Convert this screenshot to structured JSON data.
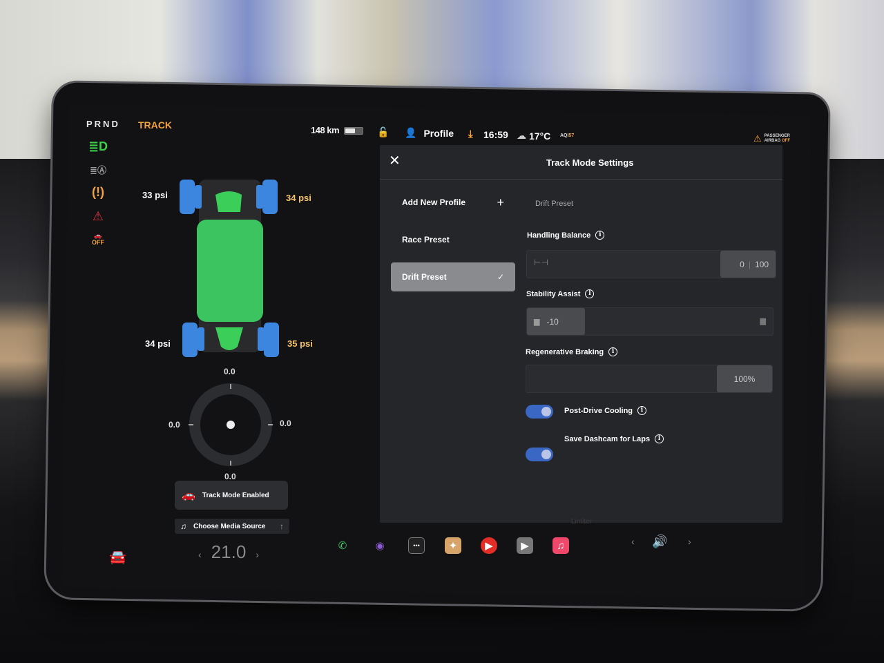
{
  "status_bar": {
    "gear": "PRND",
    "drive_mode": "TRACK",
    "range": "148 km",
    "battery_level": 0.55,
    "profile_label": "Profile",
    "time": "16:59",
    "temperature": "17°C",
    "aqi_label": "AQI",
    "aqi_value": "57",
    "airbag_line1": "PASSENGER",
    "airbag_line2": "AIRBAG",
    "airbag_state": "OFF"
  },
  "telltales": [
    {
      "icon": "headlights-on-icon",
      "color": "#3ecf4a"
    },
    {
      "icon": "auto-high-beam-icon",
      "color": "#9a9a9a"
    },
    {
      "icon": "tire-pressure-warning-icon",
      "color": "#f5a33b"
    },
    {
      "icon": "seatbelt-warning-icon",
      "color": "#e8314a"
    },
    {
      "icon": "traction-control-off-icon",
      "color": "#f5a33b"
    }
  ],
  "tires": {
    "front_left": "33 psi",
    "front_right": "34 psi",
    "rear_left": "34 psi",
    "rear_right": "35 psi"
  },
  "g_meter": {
    "top": "0.0",
    "left": "0.0",
    "right": "0.0",
    "bottom": "0.0"
  },
  "track_mode_card": {
    "label": "Track Mode Enabled"
  },
  "media_card": {
    "label": "Choose Media Source"
  },
  "climate": {
    "temperature": "21.0",
    "prev": "‹",
    "next": "›"
  },
  "panel": {
    "title": "Track Mode Settings",
    "close": "✕",
    "profiles": [
      {
        "label": "Add New Profile",
        "action": "+"
      },
      {
        "label": "Race Preset",
        "action": ""
      },
      {
        "label": "Drift Preset",
        "action": "✓",
        "selected": true
      }
    ],
    "current_preset": "Drift Preset",
    "handling_balance": {
      "label": "Handling Balance",
      "front": "0",
      "rear": "100"
    },
    "stability_assist": {
      "label": "Stability Assist",
      "value": "-10"
    },
    "regen_braking": {
      "label": "Regenerative Braking",
      "value": "100%"
    },
    "toggles": [
      {
        "label": "Post-Drive Cooling",
        "on": true
      },
      {
        "label": "Save Dashcam for Laps",
        "on": true
      }
    ],
    "info_glyph": "i",
    "below_text": "Limiter"
  },
  "dock": {
    "apps": [
      {
        "name": "phone-icon",
        "glyph": "✆",
        "bg": "transparent",
        "color": "#3ecf6a"
      },
      {
        "name": "camera-icon",
        "glyph": "◉",
        "bg": "transparent",
        "color": "#8a5ad0"
      },
      {
        "name": "more-apps-icon",
        "glyph": "•••",
        "bg": "#222",
        "color": "#fff"
      },
      {
        "name": "toybox-icon",
        "glyph": "✦",
        "bg": "#d7a56a",
        "color": "#fff"
      },
      {
        "name": "youtube-music-icon",
        "glyph": "▶",
        "bg": "#e52d27",
        "color": "#fff"
      },
      {
        "name": "theater-icon",
        "glyph": "▶",
        "bg": "#777",
        "color": "#fff"
      },
      {
        "name": "apple-music-icon",
        "glyph": "♫",
        "bg": "#f0476a",
        "color": "#fff"
      }
    ],
    "prev": "‹",
    "next": "›",
    "volume_glyph": "🔊"
  }
}
